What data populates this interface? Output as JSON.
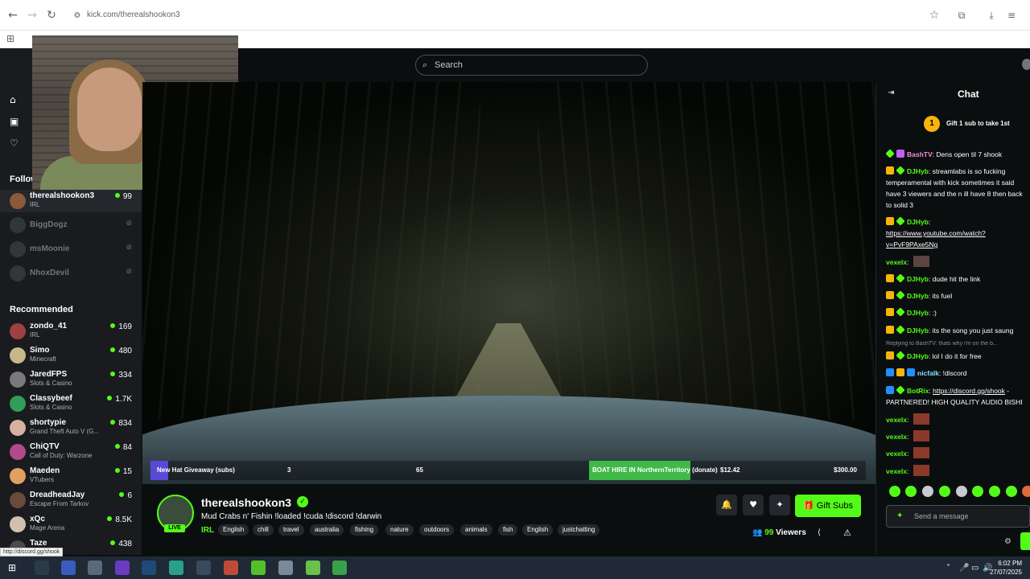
{
  "browser": {
    "url": "kick.com/therealshookon3",
    "back": "←",
    "forward": "→",
    "reload": "↻",
    "star": "☆"
  },
  "site": {
    "search_placeholder": "Search",
    "menu_icon": "☰"
  },
  "sidebar": {
    "nav_items": [
      "Home",
      "Browse",
      "Following"
    ],
    "following_label": "Following",
    "following": [
      {
        "name": "therealshookon3",
        "category": "IRL",
        "viewers": "99",
        "live": true
      },
      {
        "name": "BiggDogz",
        "live": false
      },
      {
        "name": "msMoonie",
        "live": false
      },
      {
        "name": "NhoxDevil",
        "live": false
      }
    ],
    "recommended_label": "Recommended",
    "recommended": [
      {
        "name": "zondo_41",
        "category": "IRL",
        "viewers": "169"
      },
      {
        "name": "Simo",
        "category": "Minecraft",
        "viewers": "480"
      },
      {
        "name": "JaredFPS",
        "category": "Slots & Casino",
        "viewers": "334"
      },
      {
        "name": "Classybeef",
        "category": "Slots & Casino",
        "viewers": "1.7K"
      },
      {
        "name": "shortypie",
        "category": "Grand Theft Auto V (G...",
        "viewers": "834"
      },
      {
        "name": "ChiQTV",
        "category": "Call of Duty: Warzone",
        "viewers": "84"
      },
      {
        "name": "Maeden",
        "category": "VTubers",
        "viewers": "15"
      },
      {
        "name": "DreadheadJay",
        "category": "Escape From Tarkov",
        "viewers": "6"
      },
      {
        "name": "xQc",
        "category": "Mage Arena",
        "viewers": "8.5K"
      },
      {
        "name": "Taze",
        "category": "",
        "viewers": "438"
      }
    ]
  },
  "overlay": {
    "giveaway": "New Hat Giveaway (subs)",
    "count_a": "3",
    "count_b": "65",
    "donation_goal": "BOAT HIRE IN NorthernTerritory (donate)",
    "donation_current": "$12.42",
    "donation_target": "$300.00"
  },
  "stream": {
    "streamer": "therealshookon3",
    "title": "Mud Crabs n' Fishin !loaded !cuda !discord !darwin",
    "category": "IRL",
    "live_label": "LIVE",
    "tags": [
      "English",
      "chill",
      "travel",
      "australia",
      "fishing",
      "nature",
      "outdoors",
      "animals",
      "fish",
      "English",
      "justchatting"
    ],
    "viewers": "99",
    "viewers_label": "Viewers",
    "gift_subs_label": "Gift Subs"
  },
  "chat": {
    "title": "Chat",
    "gift_banner_number": "1",
    "gift_banner": "Gift 1 sub to take 1st",
    "input_placeholder": "Send a message",
    "messages": [
      {
        "user": "BashTV",
        "text": "Dens open til 7 shook",
        "color": "pink"
      },
      {
        "user": "DJHyb",
        "text": "streamlabs is so fucking temperamental with kick sometimes it said have 3 viewers and the n ill have 8 then back to solid 3"
      },
      {
        "user": "DJHyb",
        "text": "",
        "link": "https://www.youtube.com/watch?v=PvF9PAxe5Ng"
      },
      {
        "user": "vexelx",
        "text": ""
      },
      {
        "user": "DJHyb",
        "text": "dude hit the link"
      },
      {
        "user": "DJHyb",
        "text": "its fuel"
      },
      {
        "user": "DJHyb",
        "text": ":)"
      },
      {
        "user": "DJHyb",
        "text": "its the song you just saung"
      },
      {
        "reply": "Replying to BashTV: thats why i'm on the b..."
      },
      {
        "user": "DJHyb",
        "text": "lol I do it for free"
      },
      {
        "user": "nicfalk",
        "text": "!discord",
        "color": "blue"
      },
      {
        "user": "BotRix",
        "text": " - PARTNERED! HIGH QUALITY AUDIO BISHI",
        "link": "https://discord.gg/shook"
      },
      {
        "user": "vexelx",
        "text": ""
      },
      {
        "user": "vexelx",
        "text": ""
      },
      {
        "user": "vexelx",
        "text": ""
      },
      {
        "user": "vexelx",
        "text": ""
      }
    ]
  },
  "status_url": "http://discord.gg/shook",
  "taskbar": {
    "time": "6:02 PM",
    "date": "27/07/2025"
  },
  "colors": {
    "brand_green": "#53fc18",
    "bg": "#0b0e0f",
    "sidebar": "#191b1f"
  }
}
